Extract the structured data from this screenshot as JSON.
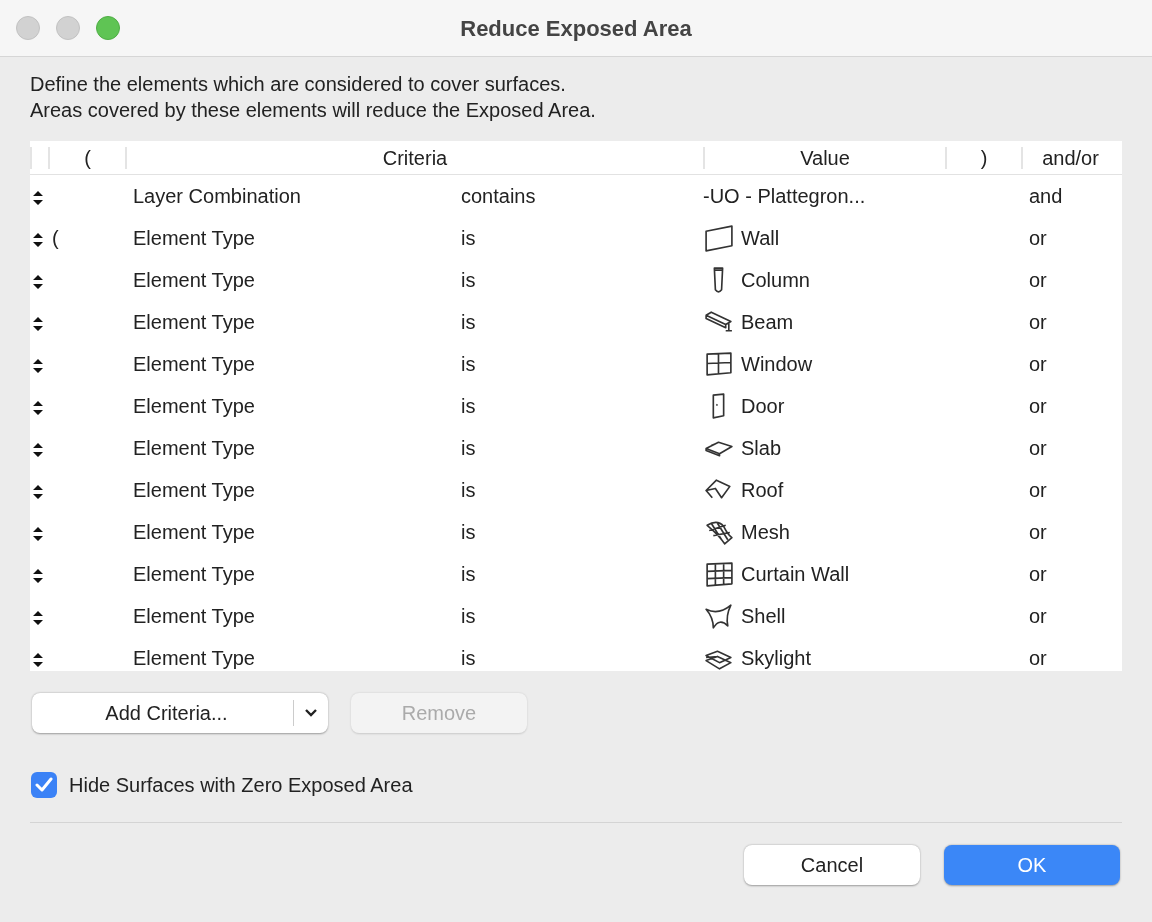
{
  "window": {
    "title": "Reduce Exposed Area"
  },
  "description": [
    "Define the elements which are considered to cover surfaces.",
    "Areas covered by these elements will reduce the Exposed Area."
  ],
  "table": {
    "columns": [
      "(",
      "Criteria",
      "Value",
      ")",
      "and/or"
    ],
    "rows": [
      {
        "open": "",
        "criterion": "Layer Combination",
        "operator": "contains",
        "value": "-UO - Plattegron...",
        "conjunction": "and"
      },
      {
        "open": "(",
        "criterion": "Element Type",
        "operator": "is",
        "value": "Wall",
        "conjunction": "or"
      },
      {
        "open": "",
        "criterion": "Element Type",
        "operator": "is",
        "value": "Column",
        "conjunction": "or"
      },
      {
        "open": "",
        "criterion": "Element Type",
        "operator": "is",
        "value": "Beam",
        "conjunction": "or"
      },
      {
        "open": "",
        "criterion": "Element Type",
        "operator": "is",
        "value": "Window",
        "conjunction": "or"
      },
      {
        "open": "",
        "criterion": "Element Type",
        "operator": "is",
        "value": "Door",
        "conjunction": "or"
      },
      {
        "open": "",
        "criterion": "Element Type",
        "operator": "is",
        "value": "Slab",
        "conjunction": "or"
      },
      {
        "open": "",
        "criterion": "Element Type",
        "operator": "is",
        "value": "Roof",
        "conjunction": "or"
      },
      {
        "open": "",
        "criterion": "Element Type",
        "operator": "is",
        "value": "Mesh",
        "conjunction": "or"
      },
      {
        "open": "",
        "criterion": "Element Type",
        "operator": "is",
        "value": "Curtain Wall",
        "conjunction": "or"
      },
      {
        "open": "",
        "criterion": "Element Type",
        "operator": "is",
        "value": "Shell",
        "conjunction": "or"
      },
      {
        "open": "",
        "criterion": "Element Type",
        "operator": "is",
        "value": "Skylight",
        "conjunction": "or"
      }
    ]
  },
  "add_button": {
    "label": "Add Criteria..."
  },
  "remove_button": {
    "label": "Remove",
    "disabled": true
  },
  "hide_checkbox": {
    "label": "Hide Surfaces with Zero Exposed Area",
    "checked": true
  },
  "buttons": [
    {
      "label": "Cancel",
      "kind": "secondary"
    },
    {
      "label": "OK",
      "kind": "default"
    }
  ]
}
